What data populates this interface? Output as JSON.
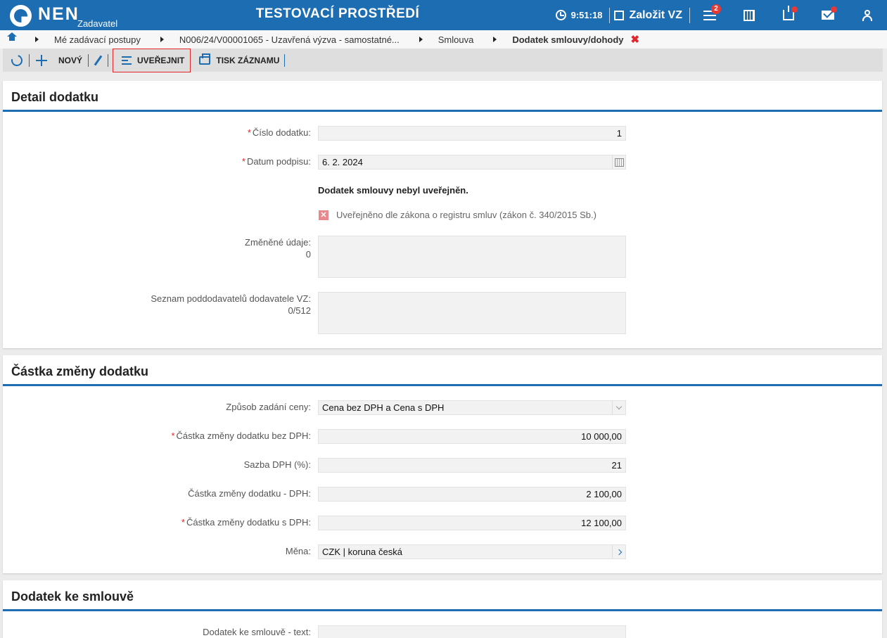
{
  "header": {
    "logo_text": "NEN",
    "logo_sub": "Zadavatel",
    "env_title": "TESTOVACÍ PROSTŘEDÍ",
    "time": "9:51:18",
    "new_vz_label": "Založit VZ",
    "menu_badge": "2",
    "icons": [
      "clock-icon",
      "edit-icon",
      "menu-icon",
      "calculator-icon",
      "inbox-icon",
      "mail-icon",
      "user-icon"
    ],
    "brand_color": "#1d6db3"
  },
  "breadcrumb": {
    "items": [
      "Mé zadávací postupy",
      "N006/24/V00001065 - Uzavřená výzva - samostatné...",
      "Smlouva"
    ],
    "current": "Dodatek smlouvy/dohody",
    "close_glyph": "✖"
  },
  "toolbar": {
    "new_label": "NOVÝ",
    "publish_label": "UVEŘEJNIT",
    "print_label": "TISK ZÁZNAMU"
  },
  "detail": {
    "title": "Detail dodatku",
    "cislo_label": "Číslo dodatku:",
    "cislo_value": "1",
    "datum_label": "Datum podpisu:",
    "datum_value": "6. 2. 2024",
    "not_published_note": "Dodatek smlouvy nebyl uveřejněn.",
    "registry_checkbox_label": "Uveřejněno dle zákona o registru smluv (zákon č. 340/2015 Sb.)",
    "registry_checkbox_glyph": "✕",
    "changed_label": "Změněné údaje:",
    "changed_count": "0",
    "changed_value": "",
    "subs_label": "Seznam poddodavatelů dodavatele VZ:",
    "subs_count": "0/512",
    "subs_value": ""
  },
  "amount": {
    "title": "Částka změny dodatku",
    "method_label": "Způsob zadání ceny:",
    "method_value": "Cena bez DPH a Cena s DPH",
    "without_vat_label": "Částka změny dodatku bez DPH:",
    "without_vat_value": "10 000,00",
    "vat_rate_label": "Sazba DPH (%):",
    "vat_rate_value": "21",
    "vat_label": "Částka změny dodatku - DPH:",
    "vat_value": "2 100,00",
    "with_vat_label": "Částka změny dodatku s DPH:",
    "with_vat_value": "12 100,00",
    "currency_label": "Měna:",
    "currency_value": "CZK | koruna česká"
  },
  "addendum": {
    "title": "Dodatek ke smlouvě",
    "text_label": "Dodatek ke smlouvě - text:"
  }
}
